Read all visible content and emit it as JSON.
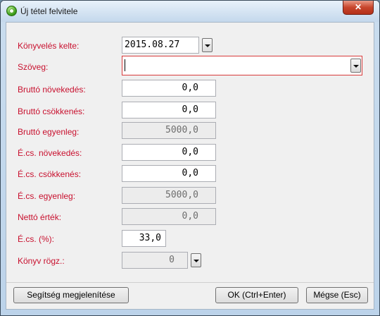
{
  "window": {
    "title": "Új tétel felvitele",
    "close_symbol": "✕"
  },
  "fields": {
    "konyveles_kelte": {
      "label": "Könyvelés kelte:",
      "value": "2015.08.27"
    },
    "szoveg": {
      "label": "Szöveg:",
      "value": ""
    },
    "brutto_novekedes": {
      "label": "Bruttó növekedés:",
      "value": "0,0"
    },
    "brutto_csokkenes": {
      "label": "Bruttó csökkenés:",
      "value": "0,0"
    },
    "brutto_egyenleg": {
      "label": "Bruttó egyenleg:",
      "value": "5000,0"
    },
    "ecs_novekedes": {
      "label": "É.cs. növekedés:",
      "value": "0,0"
    },
    "ecs_csokkenes": {
      "label": "É.cs. csökkenés:",
      "value": "0,0"
    },
    "ecs_egyenleg": {
      "label": "É.cs. egyenleg:",
      "value": "5000,0"
    },
    "netto_ertek": {
      "label": "Nettó érték:",
      "value": "0,0"
    },
    "ecs_szazalek": {
      "label": "É.cs. (%):",
      "value": "33,0"
    },
    "konyv_rogz": {
      "label": "Könyv rögz.:",
      "value": "0"
    }
  },
  "buttons": {
    "help": "Segítség megjelenítése",
    "ok": "OK (Ctrl+Enter)",
    "cancel": "Mégse (Esc)"
  },
  "colors": {
    "label_red": "#c8102e",
    "focus_border": "#d83a3a"
  }
}
